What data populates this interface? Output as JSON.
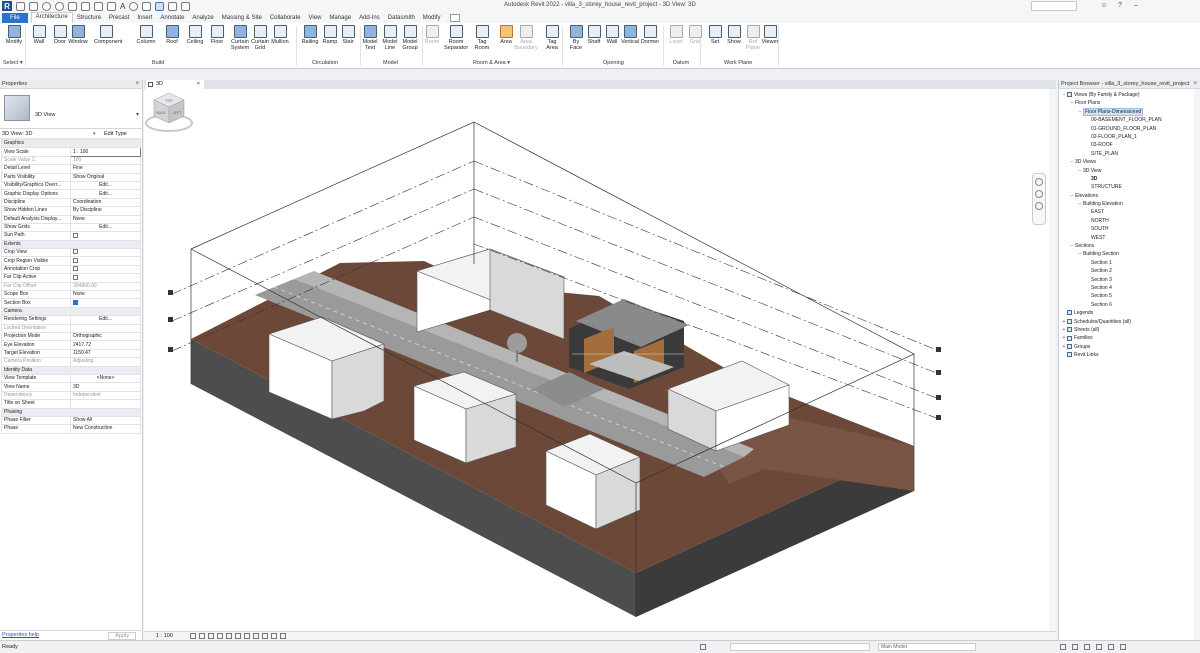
{
  "window_title": "Autodesk Revit 2022 - villa_3_storey_house_revit_project - 3D View: 3D",
  "app_logo": "R",
  "qat_icons": [
    "open-icon",
    "save-icon",
    "undo-icon",
    "redo-icon",
    "print-icon",
    "measure-icon",
    "dimension-icon",
    "tag-icon",
    "text-icon",
    "3d-view-icon",
    "section-icon",
    "thin-lines-icon",
    "close-hidden-icon",
    "switch-windows-icon"
  ],
  "qat_text_glyph": "A",
  "tabs": [
    "File",
    "Architecture",
    "Structure",
    "Precast",
    "Insert",
    "Annotate",
    "Analyze",
    "Massing & Site",
    "Collaborate",
    "View",
    "Manage",
    "Add-Ins",
    "Datasmith",
    "Modify"
  ],
  "active_tab": "Architecture",
  "ribbon": {
    "select_label": "Select ▾",
    "panels": {
      "build": "Build",
      "circulation": "Circulation",
      "model": "Model",
      "room_area": "Room & Area ▾",
      "opening": "Opening",
      "datum": "Datum",
      "work_plane": "Work Plane"
    },
    "buttons": [
      {
        "l1": "Modify",
        "l2": ""
      },
      {
        "l1": "Wall",
        "l2": ""
      },
      {
        "l1": "Door",
        "l2": ""
      },
      {
        "l1": "Window",
        "l2": ""
      },
      {
        "l1": "Component",
        "l2": ""
      },
      {
        "l1": "Column",
        "l2": ""
      },
      {
        "l1": "Roof",
        "l2": ""
      },
      {
        "l1": "Ceiling",
        "l2": ""
      },
      {
        "l1": "Floor",
        "l2": ""
      },
      {
        "l1": "Curtain",
        "l2": "System"
      },
      {
        "l1": "Curtain",
        "l2": "Grid"
      },
      {
        "l1": "Mullion",
        "l2": ""
      },
      {
        "l1": "Railing",
        "l2": ""
      },
      {
        "l1": "Ramp",
        "l2": ""
      },
      {
        "l1": "Stair",
        "l2": ""
      },
      {
        "l1": "Model",
        "l2": "Text"
      },
      {
        "l1": "Model",
        "l2": "Line"
      },
      {
        "l1": "Model",
        "l2": "Group"
      },
      {
        "l1": "Room",
        "l2": ""
      },
      {
        "l1": "Room",
        "l2": "Separator"
      },
      {
        "l1": "Tag",
        "l2": "Room"
      },
      {
        "l1": "Area",
        "l2": ""
      },
      {
        "l1": "Area",
        "l2": "Boundary"
      },
      {
        "l1": "Tag",
        "l2": "Area"
      },
      {
        "l1": "By",
        "l2": "Face"
      },
      {
        "l1": "Shaft",
        "l2": ""
      },
      {
        "l1": "Wall",
        "l2": ""
      },
      {
        "l1": "Vertical",
        "l2": ""
      },
      {
        "l1": "Dormer",
        "l2": ""
      },
      {
        "l1": "Level",
        "l2": ""
      },
      {
        "l1": "Grid",
        "l2": ""
      },
      {
        "l1": "Set",
        "l2": ""
      },
      {
        "l1": "Show",
        "l2": ""
      },
      {
        "l1": "Ref",
        "l2": "Plane"
      },
      {
        "l1": "Viewer",
        "l2": ""
      }
    ]
  },
  "properties": {
    "header": "Properties",
    "type_name": "3D View",
    "instance": "3D View: 3D",
    "edit_type": "Edit Type",
    "rows": [
      {
        "g": "Graphics"
      },
      {
        "k": "View Scale",
        "v": "1 : 100",
        "boxed": true
      },
      {
        "k": "Scale Value    1:",
        "v": "100",
        "dim": true
      },
      {
        "k": "Detail Level",
        "v": "Fine"
      },
      {
        "k": "Parts Visibility",
        "v": "Show Original"
      },
      {
        "k": "Visibility/Graphics Overr...",
        "v": "Edit...",
        "btn": true
      },
      {
        "k": "Graphic Display Options",
        "v": "Edit...",
        "btn": true
      },
      {
        "k": "Discipline",
        "v": "Coordination"
      },
      {
        "k": "Show Hidden Lines",
        "v": "By Discipline"
      },
      {
        "k": "Default Analysis Display...",
        "v": "None"
      },
      {
        "k": "Show Grids",
        "v": "Edit...",
        "btn": true
      },
      {
        "k": "Sun Path",
        "chk": false
      },
      {
        "g": "Extents"
      },
      {
        "k": "Crop View",
        "chk": false
      },
      {
        "k": "Crop Region Visible",
        "chk": false
      },
      {
        "k": "Annotation Crop",
        "chk": false
      },
      {
        "k": "Far Clip Active",
        "chk": false
      },
      {
        "k": "Far Clip Offset",
        "v": "304800.00",
        "dim": true
      },
      {
        "k": "Scope Box",
        "v": "None"
      },
      {
        "k": "Section Box",
        "chk": true
      },
      {
        "g": "Camera"
      },
      {
        "k": "Rendering Settings",
        "v": "Edit...",
        "btn": true
      },
      {
        "k": "Locked Orientation",
        "v": "",
        "dim": true
      },
      {
        "k": "Projection Mode",
        "v": "Orthographic"
      },
      {
        "k": "Eye Elevation",
        "v": "2417.72"
      },
      {
        "k": "Target Elevation",
        "v": "1150.47"
      },
      {
        "k": "Camera Position",
        "v": "Adjusting",
        "dim": true
      },
      {
        "g": "Identity Data"
      },
      {
        "k": "View Template",
        "v": "<None>",
        "btn": true
      },
      {
        "k": "View Name",
        "v": "3D"
      },
      {
        "k": "Dependency",
        "v": "Independent",
        "dim": true
      },
      {
        "k": "Title on Sheet",
        "v": ""
      },
      {
        "g": "Phasing"
      },
      {
        "k": "Phase Filter",
        "v": "Show All"
      },
      {
        "k": "Phase",
        "v": "New Construction"
      }
    ],
    "help_link": "Properties help",
    "apply_label": "Apply"
  },
  "view": {
    "tab_label": "3D",
    "close_glyph": "×",
    "scale": "1 : 100",
    "cube_faces": {
      "top": "TOP",
      "left": "BACK",
      "right": "LEFT"
    }
  },
  "browser": {
    "header": "Project Browser - villa_3_storey_house_revit_project",
    "nodes": [
      {
        "d": 0,
        "t": "−",
        "l": "Views (By Family & Package)",
        "i": true
      },
      {
        "d": 1,
        "t": "−",
        "l": "Floor Plans"
      },
      {
        "d": 2,
        "t": "−",
        "l": "Floor Plans-Dimensioned",
        "sel": true
      },
      {
        "d": 3,
        "t": "",
        "l": "00-BASEMENT_FLOOR_PLAN"
      },
      {
        "d": 3,
        "t": "",
        "l": "01-GROUND_FLOOR_PLAN"
      },
      {
        "d": 3,
        "t": "",
        "l": "02-FLOOR_PLAN_1"
      },
      {
        "d": 3,
        "t": "",
        "l": "03-ROOF"
      },
      {
        "d": 3,
        "t": "",
        "l": "SITE_PLAN"
      },
      {
        "d": 1,
        "t": "−",
        "l": "3D Views"
      },
      {
        "d": 2,
        "t": "−",
        "l": "3D View"
      },
      {
        "d": 3,
        "t": "",
        "l": "3D",
        "b": true
      },
      {
        "d": 3,
        "t": "",
        "l": "STRUCTURE"
      },
      {
        "d": 1,
        "t": "−",
        "l": "Elevations"
      },
      {
        "d": 2,
        "t": "−",
        "l": "Building Elevation"
      },
      {
        "d": 3,
        "t": "",
        "l": "EAST"
      },
      {
        "d": 3,
        "t": "",
        "l": "NORTH"
      },
      {
        "d": 3,
        "t": "",
        "l": "SOUTH"
      },
      {
        "d": 3,
        "t": "",
        "l": "WEST"
      },
      {
        "d": 1,
        "t": "−",
        "l": "Sections"
      },
      {
        "d": 2,
        "t": "−",
        "l": "Building Section"
      },
      {
        "d": 3,
        "t": "",
        "l": "Section 1"
      },
      {
        "d": 3,
        "t": "",
        "l": "Section 2"
      },
      {
        "d": 3,
        "t": "",
        "l": "Section 3"
      },
      {
        "d": 3,
        "t": "",
        "l": "Section 4"
      },
      {
        "d": 3,
        "t": "",
        "l": "Section 5"
      },
      {
        "d": 3,
        "t": "",
        "l": "Section 6"
      },
      {
        "d": 0,
        "t": "",
        "l": "Legends",
        "i": true
      },
      {
        "d": 0,
        "t": "+",
        "l": "Schedules/Quantities (all)",
        "i": true
      },
      {
        "d": 0,
        "t": "+",
        "l": "Sheets (all)",
        "i": true
      },
      {
        "d": 0,
        "t": "+",
        "l": "Families",
        "i": true
      },
      {
        "d": 0,
        "t": "+",
        "l": "Groups",
        "i": true
      },
      {
        "d": 0,
        "t": "",
        "l": "Revit Links",
        "i": true
      }
    ]
  },
  "status": {
    "text": "Ready",
    "model": "Main Model"
  },
  "colors": {
    "accent": "#2a73cc",
    "terrain": "#6e4a3a",
    "road": "#9a9a9a",
    "base": "#5a5a5a"
  }
}
